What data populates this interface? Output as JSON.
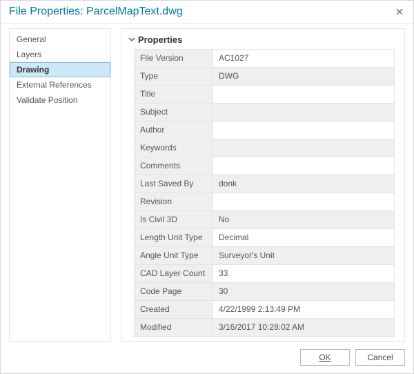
{
  "window": {
    "title": "File Properties: ParcelMapText.dwg"
  },
  "sidebar": {
    "items": [
      {
        "label": "General"
      },
      {
        "label": "Layers"
      },
      {
        "label": "Drawing",
        "selected": true
      },
      {
        "label": "External References"
      },
      {
        "label": "Validate Position"
      }
    ]
  },
  "section": {
    "title": "Properties"
  },
  "properties": [
    {
      "key": "File Version",
      "value": "AC1027"
    },
    {
      "key": "Type",
      "value": "DWG"
    },
    {
      "key": "Title",
      "value": ""
    },
    {
      "key": "Subject",
      "value": ""
    },
    {
      "key": "Author",
      "value": ""
    },
    {
      "key": "Keywords",
      "value": ""
    },
    {
      "key": "Comments",
      "value": ""
    },
    {
      "key": "Last Saved By",
      "value": "donk"
    },
    {
      "key": "Revision",
      "value": ""
    },
    {
      "key": "Is Civil 3D",
      "value": "No"
    },
    {
      "key": "Length Unit Type",
      "value": "Decimal"
    },
    {
      "key": "Angle Unit Type",
      "value": "Surveyor's Unit"
    },
    {
      "key": "CAD Layer Count",
      "value": "33"
    },
    {
      "key": "Code Page",
      "value": "30"
    },
    {
      "key": "Created",
      "value": "4/22/1999 2:13:49 PM"
    },
    {
      "key": "Modified",
      "value": "3/16/2017 10:28:02 AM"
    }
  ],
  "footer": {
    "ok": "OK",
    "cancel": "Cancel"
  }
}
